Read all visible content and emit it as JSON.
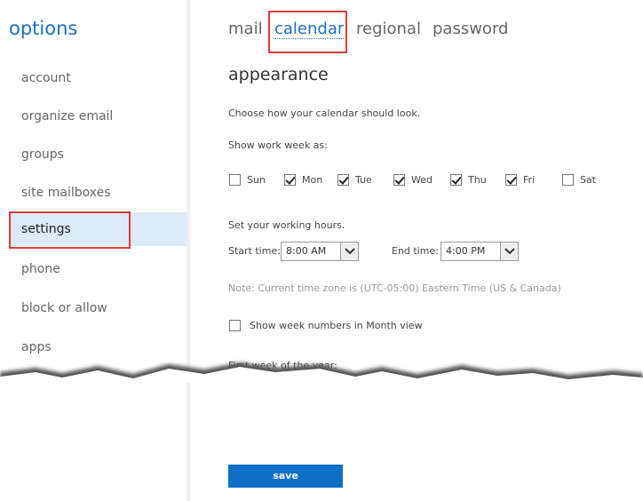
{
  "sidebar": {
    "title": "options",
    "items": [
      {
        "label": "account"
      },
      {
        "label": "organize email"
      },
      {
        "label": "groups"
      },
      {
        "label": "site mailboxes"
      },
      {
        "label": "settings",
        "selected": true
      },
      {
        "label": "phone"
      },
      {
        "label": "block or allow"
      },
      {
        "label": "apps"
      }
    ]
  },
  "tabs": [
    {
      "label": "mail"
    },
    {
      "label": "calendar",
      "active": true
    },
    {
      "label": "regional"
    },
    {
      "label": "password"
    }
  ],
  "appearance": {
    "title": "appearance",
    "description": "Choose how your calendar should look.",
    "work_week_label": "Show work week as:",
    "days": [
      {
        "label": "Sun",
        "checked": false
      },
      {
        "label": "Mon",
        "checked": true
      },
      {
        "label": "Tue",
        "checked": true
      },
      {
        "label": "Wed",
        "checked": true
      },
      {
        "label": "Thu",
        "checked": true
      },
      {
        "label": "Fri",
        "checked": true
      },
      {
        "label": "Sat",
        "checked": false
      }
    ],
    "working_hours_label": "Set your working hours.",
    "start_time_label": "Start time:",
    "start_time_value": "8:00 AM",
    "end_time_label": "End time:",
    "end_time_value": "4:00 PM",
    "timezone_note": "Note: Current time zone is (UTC-05:00) Eastern Time (US & Canada)",
    "week_numbers_label": "Show week numbers in Month view",
    "week_numbers_checked": false,
    "first_week_label": "First week of the year:"
  },
  "save_label": "save",
  "colors": {
    "accent": "#1f6fbf",
    "highlight_box": "#e03a3a",
    "selected_nav_bg": "#ddeaf7",
    "save_button": "#0f6fc6"
  }
}
